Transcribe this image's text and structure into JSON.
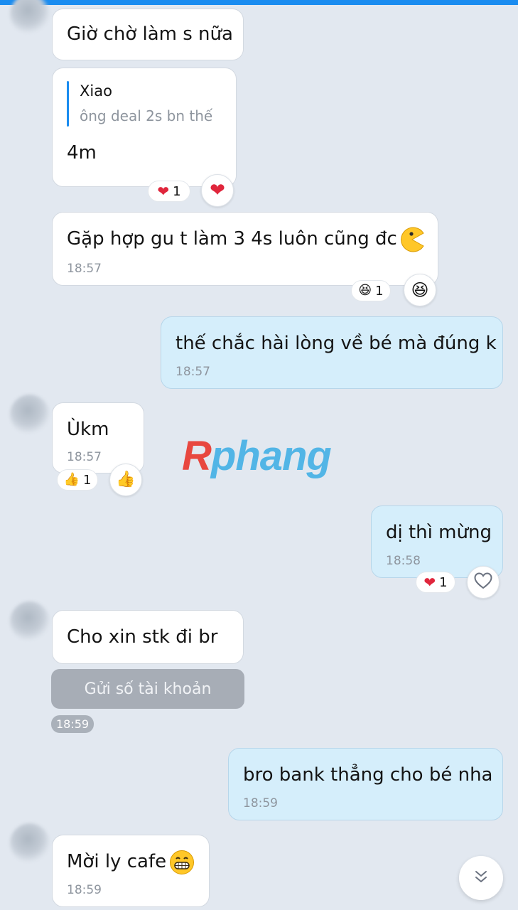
{
  "messages": [
    {
      "text": "Giờ chờ làm s nữa"
    },
    {
      "quote_name": "Xiao",
      "quote_text": "ông deal 2s bn thế",
      "text": "4m",
      "reaction": {
        "emoji": "❤",
        "count": "1"
      }
    },
    {
      "text": "Gặp hợp gu t làm 3 4s luôn cũng đc",
      "time": "18:57",
      "reaction": {
        "emoji": "😆",
        "count": "1"
      }
    },
    {
      "text": "thế chắc hài lòng về bé mà đúng k",
      "time": "18:57"
    },
    {
      "text": "Ùkm",
      "time": "18:57",
      "reaction": {
        "emoji": "👍",
        "count": "1"
      }
    },
    {
      "text": "dị thì mừng",
      "time": "18:58",
      "reaction": {
        "emoji": "❤",
        "count": "1"
      }
    },
    {
      "text": "Cho xin stk đi br",
      "action_button": "Gửi số tài khoản",
      "time": "18:59"
    },
    {
      "text": "bro bank thẳng cho bé nha",
      "time": "18:59"
    },
    {
      "text": "Mời ly cafe",
      "time": "18:59"
    }
  ],
  "watermark": {
    "first": "R",
    "rest": "phang"
  },
  "icons": {
    "heart": "heart-icon",
    "heart_outline": "heart-outline-icon",
    "laugh": "laughing-face-icon",
    "thumbs_up": "thumbs-up-icon",
    "pacman": "pacman-emoji-icon",
    "grin": "grinning-face-icon",
    "scroll_down": "double-chevron-down-icon"
  },
  "colors": {
    "accent": "#1a8cf0",
    "outgoing_bubble": "#d5eefb",
    "incoming_bubble": "#ffffff",
    "background": "#e2e8f0"
  }
}
